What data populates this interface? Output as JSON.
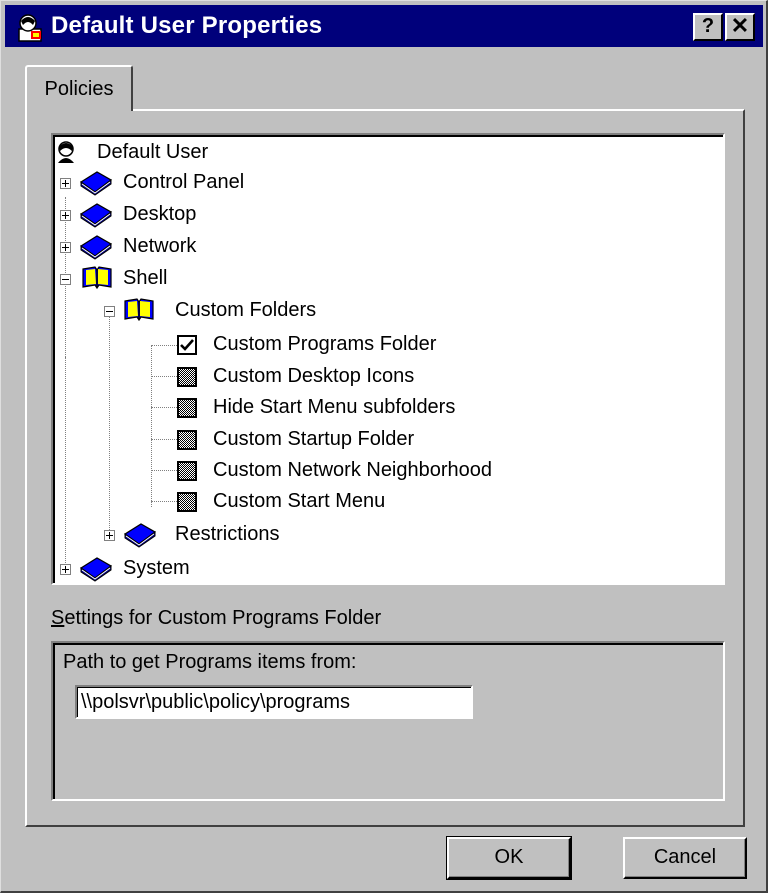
{
  "window": {
    "title": "Default User Properties",
    "help_label": "?",
    "close_label": "✕"
  },
  "tabs": [
    {
      "label": "Policies"
    }
  ],
  "tree": {
    "root": "Default User",
    "items": {
      "control_panel": "Control Panel",
      "desktop": "Desktop",
      "network": "Network",
      "shell": "Shell",
      "custom_folders": "Custom Folders",
      "custom_programs_folder": "Custom Programs Folder",
      "custom_desktop_icons": "Custom Desktop Icons",
      "hide_start_menu_subfolders": "Hide Start Menu subfolders",
      "custom_startup_folder": "Custom Startup Folder",
      "custom_network_neighborhood": "Custom Network Neighborhood",
      "custom_start_menu": "Custom Start Menu",
      "restrictions": "Restrictions",
      "system": "System"
    }
  },
  "settings": {
    "label_accel": "S",
    "label_rest": "ettings for Custom Programs Folder",
    "path_label": "Path to get Programs items from:",
    "path_value": "\\\\polsvr\\public\\policy\\programs"
  },
  "buttons": {
    "ok": "OK",
    "cancel": "Cancel"
  },
  "colors": {
    "titlebar": "#00007b",
    "face": "#c0c0c0",
    "book_blue": "#0000ff",
    "book_yellow": "#ffff00"
  }
}
